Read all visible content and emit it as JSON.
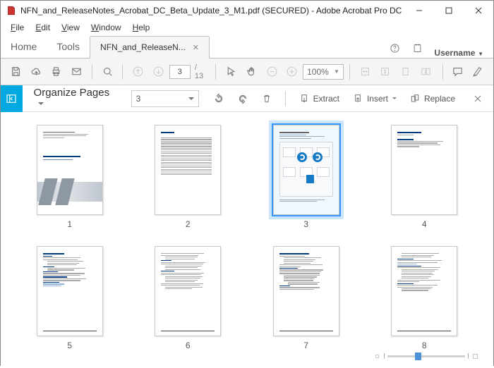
{
  "window": {
    "title": "NFN_and_ReleaseNotes_Acrobat_DC_Beta_Update_3_M1.pdf (SECURED) - Adobe Acrobat Pro DC"
  },
  "menu": {
    "file": "File",
    "edit": "Edit",
    "view": "View",
    "window": "Window",
    "help": "Help"
  },
  "tabs": {
    "home": "Home",
    "tools": "Tools",
    "doc": "NFN_and_ReleaseN..."
  },
  "user": {
    "signin": "Username"
  },
  "nav": {
    "page": "3",
    "total": "/  13",
    "zoom": "100%"
  },
  "organize": {
    "title": "Organize Pages",
    "selected": "3",
    "extract": "Extract",
    "insert": "Insert",
    "replace": "Replace"
  },
  "pages": [
    {
      "num": "1"
    },
    {
      "num": "2"
    },
    {
      "num": "3"
    },
    {
      "num": "4"
    },
    {
      "num": "5"
    },
    {
      "num": "6"
    },
    {
      "num": "7"
    },
    {
      "num": "8"
    }
  ]
}
